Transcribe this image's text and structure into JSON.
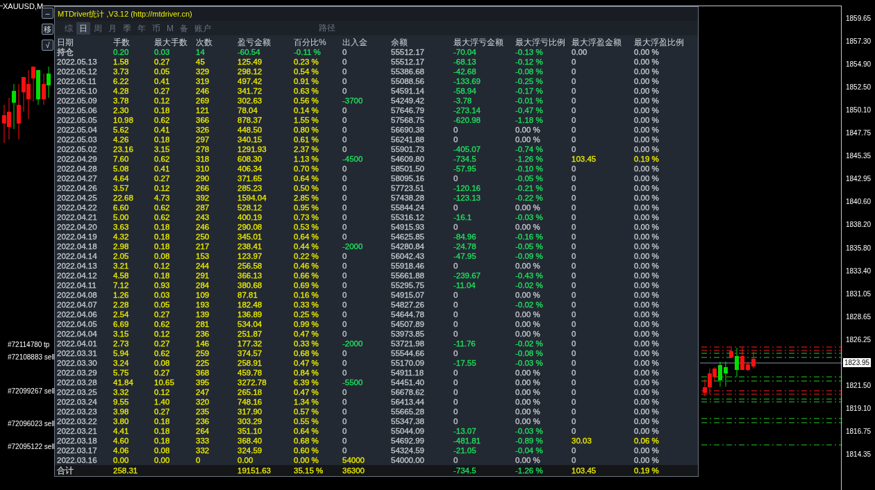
{
  "chart": {
    "symbol": "XAUUSD,M",
    "price_labels": [
      "1859.65",
      "1857.30",
      "1854.90",
      "1852.50",
      "1850.10",
      "1847.75",
      "1845.35",
      "1842.95",
      "1840.60",
      "1838.20",
      "1835.80",
      "1833.40",
      "1831.05",
      "1828.65",
      "1826.25",
      "1821.50",
      "1819.10",
      "1816.75",
      "1814.35"
    ],
    "current_price": "1823.95",
    "order_labels": [
      "#72114780 tp",
      "#72108883 sell",
      "#72099267 sell",
      "#72096023 sell",
      "#72095122 sell"
    ]
  },
  "side_buttons": [
    "–",
    "移",
    "√"
  ],
  "panel": {
    "title": "MTDriver统计 ,V3.12 (http://mtdriver.cn)",
    "tabs": [
      {
        "label": "综",
        "selected": false
      },
      {
        "label": "日",
        "selected": true
      },
      {
        "label": "周",
        "selected": false
      },
      {
        "label": "月",
        "selected": false
      },
      {
        "label": "季",
        "selected": false
      },
      {
        "label": "年",
        "selected": false
      },
      {
        "label": "币",
        "selected": false
      },
      {
        "label": "M",
        "selected": false
      },
      {
        "label": "备",
        "selected": false
      },
      {
        "label": "账户",
        "selected": false
      }
    ],
    "path_label": "路径",
    "columns": [
      "日期",
      "手数",
      "最大手数",
      "次数",
      "盈亏金额",
      "百分比%",
      "出入金",
      "余额",
      "最大浮亏金额",
      "最大浮亏比例",
      "最大浮盈金额",
      "最大浮盈比例"
    ],
    "rows": [
      {
        "kind": "holding",
        "cells": [
          "持仓",
          "0.20",
          "0.03",
          "14",
          "-60.54",
          "-0.11 %",
          {
            "text": "0",
            "color": "#c2c6cc"
          },
          "55512.17",
          {
            "text": "-70.04",
            "color": "#1fe060"
          },
          {
            "text": "-0.13 %",
            "color": "#1fe060"
          },
          {
            "text": "0.00",
            "color": "#c2c6cc"
          },
          {
            "text": "0.00 %",
            "color": "#c2c6cc"
          }
        ]
      },
      {
        "kind": "day",
        "cells": [
          "2022.05.13",
          "1.58",
          "0.27",
          "45",
          "125.49",
          "0.23 %",
          {
            "text": "0",
            "color": "#c2c6cc"
          },
          "55512.17",
          {
            "text": "-68.13",
            "color": "#1fe060"
          },
          {
            "text": "-0.12 %",
            "color": "#1fe060"
          },
          {
            "text": "0",
            "color": "#c2c6cc"
          },
          {
            "text": "0.00 %",
            "color": "#c2c6cc"
          }
        ]
      },
      {
        "kind": "day",
        "cells": [
          "2022.05.12",
          "3.73",
          "0.05",
          "329",
          "298.12",
          "0.54 %",
          {
            "text": "0",
            "color": "#c2c6cc"
          },
          "55386.68",
          {
            "text": "-42.68",
            "color": "#1fe060"
          },
          {
            "text": "-0.08 %",
            "color": "#1fe060"
          },
          {
            "text": "0",
            "color": "#c2c6cc"
          },
          {
            "text": "0.00 %",
            "color": "#c2c6cc"
          }
        ]
      },
      {
        "kind": "day",
        "cells": [
          "2022.05.11",
          "6.22",
          "0.41",
          "319",
          "497.42",
          "0.91 %",
          {
            "text": "0",
            "color": "#c2c6cc"
          },
          "55088.56",
          {
            "text": "-133.69",
            "color": "#1fe060"
          },
          {
            "text": "-0.25 %",
            "color": "#1fe060"
          },
          {
            "text": "0",
            "color": "#c2c6cc"
          },
          {
            "text": "0.00 %",
            "color": "#c2c6cc"
          }
        ]
      },
      {
        "kind": "day",
        "cells": [
          "2022.05.10",
          "4.28",
          "0.27",
          "246",
          "341.72",
          "0.63 %",
          {
            "text": "0",
            "color": "#c2c6cc"
          },
          "54591.14",
          {
            "text": "-58.94",
            "color": "#1fe060"
          },
          {
            "text": "-0.17 %",
            "color": "#1fe060"
          },
          {
            "text": "0",
            "color": "#c2c6cc"
          },
          {
            "text": "0.00 %",
            "color": "#c2c6cc"
          }
        ]
      },
      {
        "kind": "day",
        "cells": [
          "2022.05.09",
          "3.78",
          "0.12",
          "269",
          "302.63",
          "0.56 %",
          {
            "text": "-3700",
            "color": "#1fe060"
          },
          "54249.42",
          {
            "text": "-3.78",
            "color": "#1fe060"
          },
          {
            "text": "-0.01 %",
            "color": "#1fe060"
          },
          {
            "text": "0",
            "color": "#c2c6cc"
          },
          {
            "text": "0.00 %",
            "color": "#c2c6cc"
          }
        ]
      },
      {
        "kind": "day",
        "cells": [
          "2022.05.06",
          "2.30",
          "0.18",
          "121",
          "78.04",
          "0.14 %",
          {
            "text": "0",
            "color": "#c2c6cc"
          },
          "57646.79",
          {
            "text": "-273.14",
            "color": "#1fe060"
          },
          {
            "text": "-0.47 %",
            "color": "#1fe060"
          },
          {
            "text": "0",
            "color": "#c2c6cc"
          },
          {
            "text": "0.00 %",
            "color": "#c2c6cc"
          }
        ]
      },
      {
        "kind": "day",
        "cells": [
          "2022.05.05",
          "10.98",
          "0.62",
          "366",
          "878.37",
          "1.55 %",
          {
            "text": "0",
            "color": "#c2c6cc"
          },
          "57568.75",
          {
            "text": "-620.98",
            "color": "#1fe060"
          },
          {
            "text": "-1.18 %",
            "color": "#1fe060"
          },
          {
            "text": "0",
            "color": "#c2c6cc"
          },
          {
            "text": "0.00 %",
            "color": "#c2c6cc"
          }
        ]
      },
      {
        "kind": "day",
        "cells": [
          "2022.05.04",
          "5.62",
          "0.41",
          "326",
          "448.50",
          "0.80 %",
          {
            "text": "0",
            "color": "#c2c6cc"
          },
          "56690.38",
          {
            "text": "0",
            "color": "#c2c6cc"
          },
          {
            "text": "0.00 %",
            "color": "#c2c6cc"
          },
          {
            "text": "0",
            "color": "#c2c6cc"
          },
          {
            "text": "0.00 %",
            "color": "#c2c6cc"
          }
        ]
      },
      {
        "kind": "day",
        "cells": [
          "2022.05.03",
          "4.26",
          "0.18",
          "297",
          "340.15",
          "0.61 %",
          {
            "text": "0",
            "color": "#c2c6cc"
          },
          "56241.88",
          {
            "text": "0",
            "color": "#c2c6cc"
          },
          {
            "text": "0.00 %",
            "color": "#c2c6cc"
          },
          {
            "text": "0",
            "color": "#c2c6cc"
          },
          {
            "text": "0.00 %",
            "color": "#c2c6cc"
          }
        ]
      },
      {
        "kind": "day",
        "cells": [
          "2022.05.02",
          "23.16",
          "3.15",
          "278",
          "1291.93",
          "2.37 %",
          {
            "text": "0",
            "color": "#c2c6cc"
          },
          "55901.73",
          {
            "text": "-405.07",
            "color": "#1fe060"
          },
          {
            "text": "-0.74 %",
            "color": "#1fe060"
          },
          {
            "text": "0",
            "color": "#c2c6cc"
          },
          {
            "text": "0.00 %",
            "color": "#c2c6cc"
          }
        ]
      },
      {
        "kind": "day",
        "cells": [
          "2022.04.29",
          "7.60",
          "0.62",
          "318",
          "608.30",
          "1.13 %",
          {
            "text": "-4500",
            "color": "#1fe060"
          },
          "54609.80",
          {
            "text": "-734.5",
            "color": "#1fe060"
          },
          {
            "text": "-1.26 %",
            "color": "#1fe060"
          },
          {
            "text": "103.45",
            "color": "#e8e800"
          },
          {
            "text": "0.19 %",
            "color": "#e8e800"
          }
        ]
      },
      {
        "kind": "day",
        "cells": [
          "2022.04.28",
          "5.08",
          "0.41",
          "310",
          "406.34",
          "0.70 %",
          {
            "text": "0",
            "color": "#c2c6cc"
          },
          "58501.50",
          {
            "text": "-57.95",
            "color": "#1fe060"
          },
          {
            "text": "-0.10 %",
            "color": "#1fe060"
          },
          {
            "text": "0",
            "color": "#c2c6cc"
          },
          {
            "text": "0.00 %",
            "color": "#c2c6cc"
          }
        ]
      },
      {
        "kind": "day",
        "cells": [
          "2022.04.27",
          "4.64",
          "0.27",
          "290",
          "371.65",
          "0.64 %",
          {
            "text": "0",
            "color": "#c2c6cc"
          },
          "58095.16",
          {
            "text": "0",
            "color": "#c2c6cc"
          },
          {
            "text": "-0.05 %",
            "color": "#1fe060"
          },
          {
            "text": "0",
            "color": "#c2c6cc"
          },
          {
            "text": "0.00 %",
            "color": "#c2c6cc"
          }
        ]
      },
      {
        "kind": "day",
        "cells": [
          "2022.04.26",
          "3.57",
          "0.12",
          "266",
          "285.23",
          "0.50 %",
          {
            "text": "0",
            "color": "#c2c6cc"
          },
          "57723.51",
          {
            "text": "-120.16",
            "color": "#1fe060"
          },
          {
            "text": "-0.21 %",
            "color": "#1fe060"
          },
          {
            "text": "0",
            "color": "#c2c6cc"
          },
          {
            "text": "0.00 %",
            "color": "#c2c6cc"
          }
        ]
      },
      {
        "kind": "day",
        "cells": [
          "2022.04.25",
          "22.68",
          "4.73",
          "392",
          "1594.04",
          "2.85 %",
          {
            "text": "0",
            "color": "#c2c6cc"
          },
          "57438.28",
          {
            "text": "-123.13",
            "color": "#1fe060"
          },
          {
            "text": "-0.22 %",
            "color": "#1fe060"
          },
          {
            "text": "0",
            "color": "#c2c6cc"
          },
          {
            "text": "0.00 %",
            "color": "#c2c6cc"
          }
        ]
      },
      {
        "kind": "day",
        "cells": [
          "2022.04.22",
          "6.60",
          "0.62",
          "287",
          "528.12",
          "0.95 %",
          {
            "text": "0",
            "color": "#c2c6cc"
          },
          "55844.24",
          {
            "text": "0",
            "color": "#c2c6cc"
          },
          {
            "text": "0.00 %",
            "color": "#c2c6cc"
          },
          {
            "text": "0",
            "color": "#c2c6cc"
          },
          {
            "text": "0.00 %",
            "color": "#c2c6cc"
          }
        ]
      },
      {
        "kind": "day",
        "cells": [
          "2022.04.21",
          "5.00",
          "0.62",
          "243",
          "400.19",
          "0.73 %",
          {
            "text": "0",
            "color": "#c2c6cc"
          },
          "55316.12",
          {
            "text": "-16.1",
            "color": "#1fe060"
          },
          {
            "text": "-0.03 %",
            "color": "#1fe060"
          },
          {
            "text": "0",
            "color": "#c2c6cc"
          },
          {
            "text": "0.00 %",
            "color": "#c2c6cc"
          }
        ]
      },
      {
        "kind": "day",
        "cells": [
          "2022.04.20",
          "3.63",
          "0.18",
          "246",
          "290.08",
          "0.53 %",
          {
            "text": "0",
            "color": "#c2c6cc"
          },
          "54915.93",
          {
            "text": "0",
            "color": "#c2c6cc"
          },
          {
            "text": "0.00 %",
            "color": "#c2c6cc"
          },
          {
            "text": "0",
            "color": "#c2c6cc"
          },
          {
            "text": "0.00 %",
            "color": "#c2c6cc"
          }
        ]
      },
      {
        "kind": "day",
        "cells": [
          "2022.04.19",
          "4.32",
          "0.18",
          "250",
          "345.01",
          "0.64 %",
          {
            "text": "0",
            "color": "#c2c6cc"
          },
          "54625.85",
          {
            "text": "-84.96",
            "color": "#1fe060"
          },
          {
            "text": "-0.16 %",
            "color": "#1fe060"
          },
          {
            "text": "0",
            "color": "#c2c6cc"
          },
          {
            "text": "0.00 %",
            "color": "#c2c6cc"
          }
        ]
      },
      {
        "kind": "day",
        "cells": [
          "2022.04.18",
          "2.98",
          "0.18",
          "217",
          "238.41",
          "0.44 %",
          {
            "text": "-2000",
            "color": "#1fe060"
          },
          "54280.84",
          {
            "text": "-24.78",
            "color": "#1fe060"
          },
          {
            "text": "-0.05 %",
            "color": "#1fe060"
          },
          {
            "text": "0",
            "color": "#c2c6cc"
          },
          {
            "text": "0.00 %",
            "color": "#c2c6cc"
          }
        ]
      },
      {
        "kind": "day",
        "cells": [
          "2022.04.14",
          "2.05",
          "0.08",
          "153",
          "123.97",
          "0.22 %",
          {
            "text": "0",
            "color": "#c2c6cc"
          },
          "56042.43",
          {
            "text": "-47.95",
            "color": "#1fe060"
          },
          {
            "text": "-0.09 %",
            "color": "#1fe060"
          },
          {
            "text": "0",
            "color": "#c2c6cc"
          },
          {
            "text": "0.00 %",
            "color": "#c2c6cc"
          }
        ]
      },
      {
        "kind": "day",
        "cells": [
          "2022.04.13",
          "3.21",
          "0.12",
          "244",
          "256.58",
          "0.46 %",
          {
            "text": "0",
            "color": "#c2c6cc"
          },
          "55918.46",
          {
            "text": "0",
            "color": "#c2c6cc"
          },
          {
            "text": "0.00 %",
            "color": "#c2c6cc"
          },
          {
            "text": "0",
            "color": "#c2c6cc"
          },
          {
            "text": "0.00 %",
            "color": "#c2c6cc"
          }
        ]
      },
      {
        "kind": "day",
        "cells": [
          "2022.04.12",
          "4.58",
          "0.18",
          "291",
          "366.13",
          "0.66 %",
          {
            "text": "0",
            "color": "#c2c6cc"
          },
          "55661.88",
          {
            "text": "-239.67",
            "color": "#1fe060"
          },
          {
            "text": "-0.43 %",
            "color": "#1fe060"
          },
          {
            "text": "0",
            "color": "#c2c6cc"
          },
          {
            "text": "0.00 %",
            "color": "#c2c6cc"
          }
        ]
      },
      {
        "kind": "day",
        "cells": [
          "2022.04.11",
          "7.12",
          "0.93",
          "284",
          "380.68",
          "0.69 %",
          {
            "text": "0",
            "color": "#c2c6cc"
          },
          "55295.75",
          {
            "text": "-11.04",
            "color": "#1fe060"
          },
          {
            "text": "-0.02 %",
            "color": "#1fe060"
          },
          {
            "text": "0",
            "color": "#c2c6cc"
          },
          {
            "text": "0.00 %",
            "color": "#c2c6cc"
          }
        ]
      },
      {
        "kind": "day",
        "cells": [
          "2022.04.08",
          "1.26",
          "0.03",
          "109",
          "87.81",
          "0.16 %",
          {
            "text": "0",
            "color": "#c2c6cc"
          },
          "54915.07",
          {
            "text": "0",
            "color": "#c2c6cc"
          },
          {
            "text": "0.00 %",
            "color": "#c2c6cc"
          },
          {
            "text": "0",
            "color": "#c2c6cc"
          },
          {
            "text": "0.00 %",
            "color": "#c2c6cc"
          }
        ]
      },
      {
        "kind": "day",
        "cells": [
          "2022.04.07",
          "2.28",
          "0.05",
          "193",
          "182.48",
          "0.33 %",
          {
            "text": "0",
            "color": "#c2c6cc"
          },
          "54827.26",
          {
            "text": "0",
            "color": "#c2c6cc"
          },
          {
            "text": "-0.02 %",
            "color": "#1fe060"
          },
          {
            "text": "0",
            "color": "#c2c6cc"
          },
          {
            "text": "0.00 %",
            "color": "#c2c6cc"
          }
        ]
      },
      {
        "kind": "day",
        "cells": [
          "2022.04.06",
          "2.54",
          "0.27",
          "139",
          "136.89",
          "0.25 %",
          {
            "text": "0",
            "color": "#c2c6cc"
          },
          "54644.78",
          {
            "text": "0",
            "color": "#c2c6cc"
          },
          {
            "text": "0.00 %",
            "color": "#c2c6cc"
          },
          {
            "text": "0",
            "color": "#c2c6cc"
          },
          {
            "text": "0.00 %",
            "color": "#c2c6cc"
          }
        ]
      },
      {
        "kind": "day",
        "cells": [
          "2022.04.05",
          "6.69",
          "0.62",
          "281",
          "534.04",
          "0.99 %",
          {
            "text": "0",
            "color": "#c2c6cc"
          },
          "54507.89",
          {
            "text": "0",
            "color": "#c2c6cc"
          },
          {
            "text": "0.00 %",
            "color": "#c2c6cc"
          },
          {
            "text": "0",
            "color": "#c2c6cc"
          },
          {
            "text": "0.00 %",
            "color": "#c2c6cc"
          }
        ]
      },
      {
        "kind": "day",
        "cells": [
          "2022.04.04",
          "3.15",
          "0.12",
          "236",
          "251.87",
          "0.47 %",
          {
            "text": "0",
            "color": "#c2c6cc"
          },
          "53973.85",
          {
            "text": "0",
            "color": "#c2c6cc"
          },
          {
            "text": "0.00 %",
            "color": "#c2c6cc"
          },
          {
            "text": "0",
            "color": "#c2c6cc"
          },
          {
            "text": "0.00 %",
            "color": "#c2c6cc"
          }
        ]
      },
      {
        "kind": "day",
        "cells": [
          "2022.04.01",
          "2.73",
          "0.27",
          "146",
          "177.32",
          "0.33 %",
          {
            "text": "-2000",
            "color": "#1fe060"
          },
          "53721.98",
          {
            "text": "-11.76",
            "color": "#1fe060"
          },
          {
            "text": "-0.02 %",
            "color": "#1fe060"
          },
          {
            "text": "0",
            "color": "#c2c6cc"
          },
          {
            "text": "0.00 %",
            "color": "#c2c6cc"
          }
        ]
      },
      {
        "kind": "day",
        "cells": [
          "2022.03.31",
          "5.94",
          "0.62",
          "259",
          "374.57",
          "0.68 %",
          {
            "text": "0",
            "color": "#c2c6cc"
          },
          "55544.66",
          {
            "text": "0",
            "color": "#c2c6cc"
          },
          {
            "text": "-0.08 %",
            "color": "#1fe060"
          },
          {
            "text": "0",
            "color": "#c2c6cc"
          },
          {
            "text": "0.00 %",
            "color": "#c2c6cc"
          }
        ]
      },
      {
        "kind": "day",
        "cells": [
          "2022.03.30",
          "3.24",
          "0.08",
          "225",
          "258.91",
          "0.47 %",
          {
            "text": "0",
            "color": "#c2c6cc"
          },
          "55170.09",
          {
            "text": "-17.55",
            "color": "#1fe060"
          },
          {
            "text": "-0.03 %",
            "color": "#1fe060"
          },
          {
            "text": "0",
            "color": "#c2c6cc"
          },
          {
            "text": "0.00 %",
            "color": "#c2c6cc"
          }
        ]
      },
      {
        "kind": "day",
        "cells": [
          "2022.03.29",
          "5.75",
          "0.27",
          "368",
          "459.78",
          "0.84 %",
          {
            "text": "0",
            "color": "#c2c6cc"
          },
          "54911.18",
          {
            "text": "0",
            "color": "#c2c6cc"
          },
          {
            "text": "0.00 %",
            "color": "#c2c6cc"
          },
          {
            "text": "0",
            "color": "#c2c6cc"
          },
          {
            "text": "0.00 %",
            "color": "#c2c6cc"
          }
        ]
      },
      {
        "kind": "day",
        "cells": [
          "2022.03.28",
          "41.84",
          "10.65",
          "395",
          "3272.78",
          "6.39 %",
          {
            "text": "-5500",
            "color": "#1fe060"
          },
          "54451.40",
          {
            "text": "0",
            "color": "#c2c6cc"
          },
          {
            "text": "0.00 %",
            "color": "#c2c6cc"
          },
          {
            "text": "0",
            "color": "#c2c6cc"
          },
          {
            "text": "0.00 %",
            "color": "#c2c6cc"
          }
        ]
      },
      {
        "kind": "day",
        "cells": [
          "2022.03.25",
          "3.32",
          "0.12",
          "247",
          "265.18",
          "0.47 %",
          {
            "text": "0",
            "color": "#c2c6cc"
          },
          "56678.62",
          {
            "text": "0",
            "color": "#c2c6cc"
          },
          {
            "text": "0.00 %",
            "color": "#c2c6cc"
          },
          {
            "text": "0",
            "color": "#c2c6cc"
          },
          {
            "text": "0.00 %",
            "color": "#c2c6cc"
          }
        ]
      },
      {
        "kind": "day",
        "cells": [
          "2022.03.24",
          "9.55",
          "1.40",
          "320",
          "748.16",
          "1.34 %",
          {
            "text": "0",
            "color": "#c2c6cc"
          },
          "56413.44",
          {
            "text": "0",
            "color": "#c2c6cc"
          },
          {
            "text": "0.00 %",
            "color": "#c2c6cc"
          },
          {
            "text": "0",
            "color": "#c2c6cc"
          },
          {
            "text": "0.00 %",
            "color": "#c2c6cc"
          }
        ]
      },
      {
        "kind": "day",
        "cells": [
          "2022.03.23",
          "3.98",
          "0.27",
          "235",
          "317.90",
          "0.57 %",
          {
            "text": "0",
            "color": "#c2c6cc"
          },
          "55665.28",
          {
            "text": "0",
            "color": "#c2c6cc"
          },
          {
            "text": "0.00 %",
            "color": "#c2c6cc"
          },
          {
            "text": "0",
            "color": "#c2c6cc"
          },
          {
            "text": "0.00 %",
            "color": "#c2c6cc"
          }
        ]
      },
      {
        "kind": "day",
        "cells": [
          "2022.03.22",
          "3.80",
          "0.18",
          "236",
          "303.29",
          "0.55 %",
          {
            "text": "0",
            "color": "#c2c6cc"
          },
          "55347.38",
          {
            "text": "0",
            "color": "#c2c6cc"
          },
          {
            "text": "0.00 %",
            "color": "#c2c6cc"
          },
          {
            "text": "0",
            "color": "#c2c6cc"
          },
          {
            "text": "0.00 %",
            "color": "#c2c6cc"
          }
        ]
      },
      {
        "kind": "day",
        "cells": [
          "2022.03.21",
          "4.41",
          "0.18",
          "264",
          "351.10",
          "0.64 %",
          {
            "text": "0",
            "color": "#c2c6cc"
          },
          "55044.09",
          {
            "text": "-13.07",
            "color": "#1fe060"
          },
          {
            "text": "-0.03 %",
            "color": "#1fe060"
          },
          {
            "text": "0",
            "color": "#c2c6cc"
          },
          {
            "text": "0.00 %",
            "color": "#c2c6cc"
          }
        ]
      },
      {
        "kind": "day",
        "cells": [
          "2022.03.18",
          "4.60",
          "0.18",
          "333",
          "368.40",
          "0.68 %",
          {
            "text": "0",
            "color": "#c2c6cc"
          },
          "54692.99",
          {
            "text": "-481.81",
            "color": "#1fe060"
          },
          {
            "text": "-0.89 %",
            "color": "#1fe060"
          },
          {
            "text": "30.03",
            "color": "#e8e800"
          },
          {
            "text": "0.06 %",
            "color": "#e8e800"
          }
        ]
      },
      {
        "kind": "day",
        "cells": [
          "2022.03.17",
          "4.06",
          "0.08",
          "332",
          "324.59",
          "0.60 %",
          {
            "text": "0",
            "color": "#c2c6cc"
          },
          "54324.59",
          {
            "text": "-21.05",
            "color": "#1fe060"
          },
          {
            "text": "-0.04 %",
            "color": "#1fe060"
          },
          {
            "text": "0",
            "color": "#c2c6cc"
          },
          {
            "text": "0.00 %",
            "color": "#c2c6cc"
          }
        ]
      },
      {
        "kind": "day",
        "cells": [
          "2022.03.16",
          "0.00",
          "0.00",
          "0",
          "0.00",
          "0.00 %",
          {
            "text": "54000",
            "color": "#e8e800"
          },
          "54000.00",
          {
            "text": "0",
            "color": "#c2c6cc"
          },
          {
            "text": "0.00 %",
            "color": "#c2c6cc"
          },
          {
            "text": "0",
            "color": "#c2c6cc"
          },
          {
            "text": "0.00 %",
            "color": "#c2c6cc"
          }
        ]
      }
    ],
    "total": {
      "cells": [
        "合计",
        "258.31",
        null,
        null,
        "19151.63",
        "35.15 %",
        {
          "text": "36300",
          "color": "#e8e800"
        },
        null,
        {
          "text": "-734.5",
          "color": "#1fe060"
        },
        {
          "text": "-1.26 %",
          "color": "#1fe060"
        },
        {
          "text": "103.45",
          "color": "#e8e800"
        },
        {
          "text": "0.19 %",
          "color": "#e8e800"
        }
      ]
    }
  }
}
